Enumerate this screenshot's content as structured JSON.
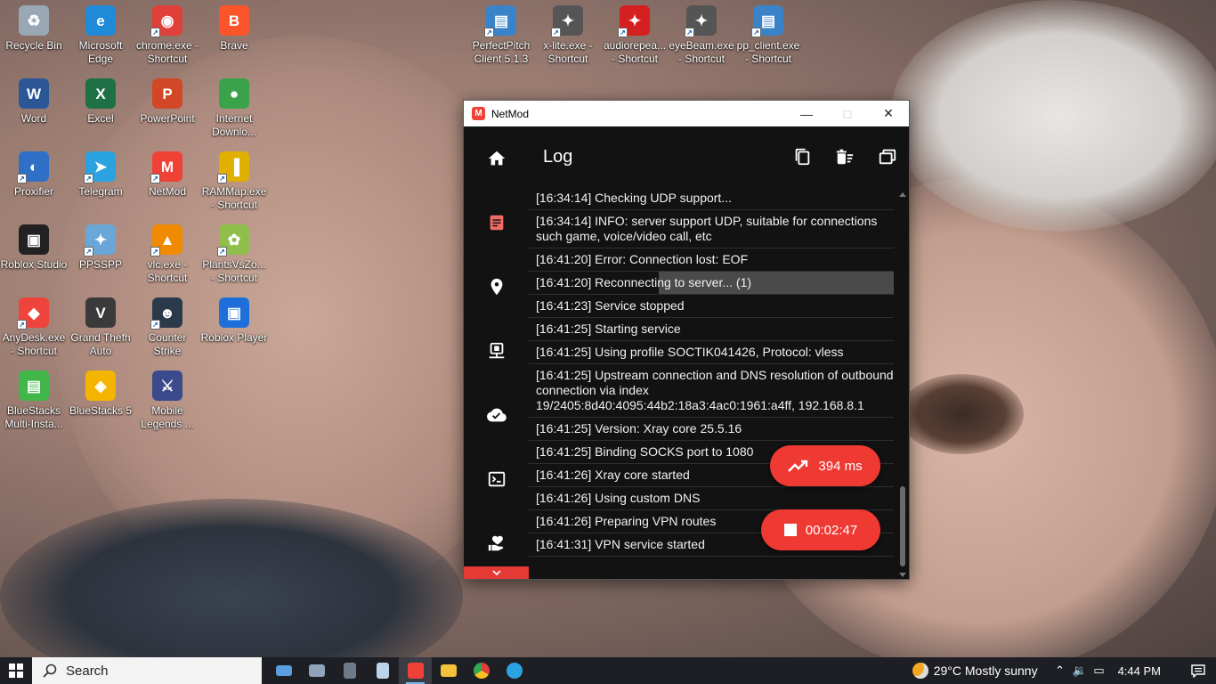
{
  "desktop": {
    "icons": [
      {
        "label": "Recycle Bin",
        "glyph": "♻",
        "color": "#9aa7b5",
        "shortcut": false
      },
      {
        "label": "Microsoft Edge",
        "glyph": "e",
        "color": "#1f8ad8",
        "shortcut": false
      },
      {
        "label": "chrome.exe - Shortcut",
        "glyph": "◉",
        "color": "#e0403a",
        "shortcut": true
      },
      {
        "label": "Brave",
        "glyph": "B",
        "color": "#fb542b",
        "shortcut": false
      },
      {
        "label": "PerfectPitch Client 5.1.3",
        "glyph": "▤",
        "color": "#3b83c8",
        "shortcut": true
      },
      {
        "label": "x-lite.exe - Shortcut",
        "glyph": "✦",
        "color": "#555555",
        "shortcut": true
      },
      {
        "label": "audiorepea... - Shortcut",
        "glyph": "✦",
        "color": "#d42020",
        "shortcut": true
      },
      {
        "label": "eyeBeam.exe - Shortcut",
        "glyph": "✦",
        "color": "#555555",
        "shortcut": true
      },
      {
        "label": "pp_client.exe - Shortcut",
        "glyph": "▤",
        "color": "#3b83c8",
        "shortcut": true
      },
      {
        "label": "Word",
        "glyph": "W",
        "color": "#2b5797",
        "shortcut": false
      },
      {
        "label": "Excel",
        "glyph": "X",
        "color": "#1e7145",
        "shortcut": false
      },
      {
        "label": "PowerPoint",
        "glyph": "P",
        "color": "#d24726",
        "shortcut": false
      },
      {
        "label": "Internet Downlo...",
        "glyph": "●",
        "color": "#3aa34a",
        "shortcut": false
      },
      {
        "label": "Proxifier",
        "glyph": "◐",
        "color": "#2f6fc6",
        "shortcut": true
      },
      {
        "label": "Telegram",
        "glyph": "➤",
        "color": "#2aa3e0",
        "shortcut": true
      },
      {
        "label": "NetMod",
        "glyph": "M",
        "color": "#ef4136",
        "shortcut": true
      },
      {
        "label": "RAMMap.exe - Shortcut",
        "glyph": "▐",
        "color": "#e0b000",
        "shortcut": true
      },
      {
        "label": "Roblox Studio",
        "glyph": "▣",
        "color": "#222222",
        "shortcut": false
      },
      {
        "label": "PPSSPP",
        "glyph": "✦",
        "color": "#6aa7d8",
        "shortcut": true
      },
      {
        "label": "vlc.exe - Shortcut",
        "glyph": "▲",
        "color": "#f08a00",
        "shortcut": true
      },
      {
        "label": "PlantsVsZo... - Shortcut",
        "glyph": "✿",
        "color": "#8fbf4a",
        "shortcut": true
      },
      {
        "label": "AnyDesk.exe - Shortcut",
        "glyph": "◆",
        "color": "#ef443b",
        "shortcut": true
      },
      {
        "label": "Grand Thefh Auto",
        "glyph": "V",
        "color": "#3a3a3a",
        "shortcut": false
      },
      {
        "label": "Counter Strike",
        "glyph": "☻",
        "color": "#2a3a4a",
        "shortcut": true
      },
      {
        "label": "Roblox Player",
        "glyph": "▣",
        "color": "#1e6fd9",
        "shortcut": false
      },
      {
        "label": "BlueStacks Multi-Insta...",
        "glyph": "▤",
        "color": "#41b649",
        "shortcut": false
      },
      {
        "label": "BlueStacks 5",
        "glyph": "◈",
        "color": "#f5b400",
        "shortcut": false
      },
      {
        "label": "Mobile Legends ...",
        "glyph": "⚔",
        "color": "#3a4a8a",
        "shortcut": false
      }
    ]
  },
  "window": {
    "title": "NetMod",
    "minimize": "—",
    "maximize": "□",
    "close": "✕",
    "page_title": "Log",
    "nav": [
      "home-icon",
      "log-icon",
      "location-icon",
      "server-icon",
      "cloud-icon",
      "terminal-icon",
      "donate-icon"
    ],
    "log": [
      "[16:34:14] Checking UDP support...",
      "[16:34:14] INFO: server support UDP, suitable for connections such game, voice/video call, etc",
      "[16:41:20] Error: Connection lost: EOF",
      "[16:41:20] Reconnecting to server... (1)",
      "[16:41:23] Service stopped",
      "[16:41:25] Starting service",
      "[16:41:25] Using profile SOCTIK041426, Protocol: vless",
      "[16:41:25] Upstream connection and DNS resolution of outbound connection via index 19/2405:8d40:4095:44b2:18a3:4ac0:1961:a4ff, 192.168.8.1",
      "[16:41:25] Version: Xray core 25.5.16",
      "[16:41:25] Binding SOCKS port to 1080",
      "[16:41:26] Xray core started",
      "[16:41:26] Using custom DNS",
      "[16:41:26] Preparing VPN routes",
      "[16:41:31] VPN service started"
    ],
    "ping": "394 ms",
    "timer": "00:02:47",
    "accent": "#ef3a34"
  },
  "taskbar": {
    "search_placeholder": "Search",
    "weather": "29°C  Mostly sunny",
    "time": "4:44 PM"
  }
}
